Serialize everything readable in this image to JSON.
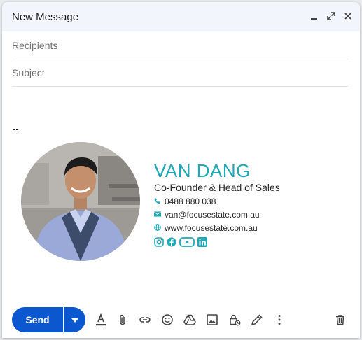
{
  "window": {
    "title": "New Message",
    "controls": [
      "minimize-icon",
      "pop-out-icon",
      "close-icon"
    ]
  },
  "fields": {
    "recipients_placeholder": "Recipients",
    "recipients_value": "",
    "subject_placeholder": "Subject",
    "subject_value": ""
  },
  "body": {
    "separator": "--",
    "signature": {
      "name": "VAN DANG",
      "role": "Co-Founder & Head of Sales",
      "phone": "0488 880 038",
      "email": "van@focusestate.com.au",
      "website": "www.focusestate.com.au",
      "socials": [
        "instagram-icon",
        "facebook-icon",
        "youtube-icon",
        "linkedin-icon"
      ],
      "accent_color": "#1fa8b8"
    }
  },
  "toolbar": {
    "send_label": "Send",
    "send_color": "#0b57d0",
    "tools": [
      "formatting-icon",
      "attach-icon",
      "link-icon",
      "emoji-icon",
      "drive-icon",
      "photo-icon",
      "confidential-icon",
      "signature-icon",
      "more-options-icon",
      "discard-icon"
    ]
  }
}
